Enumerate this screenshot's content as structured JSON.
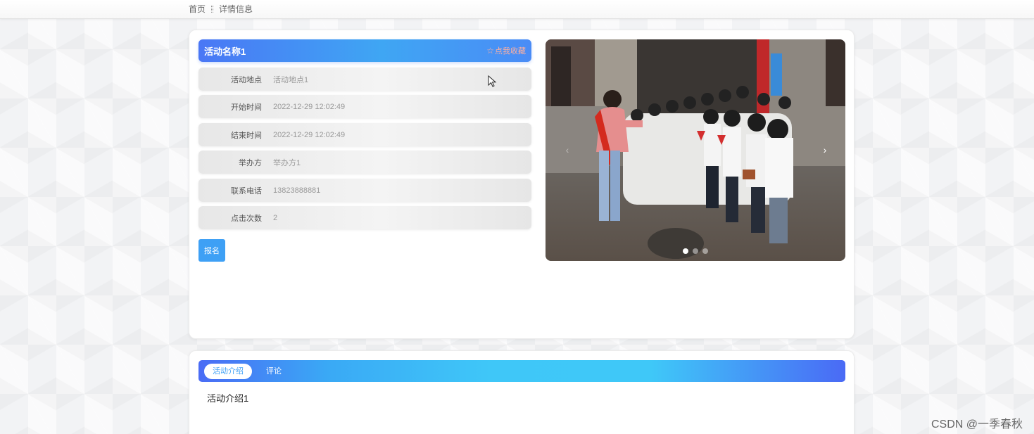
{
  "breadcrumb": {
    "home": "首页",
    "current": "详情信息"
  },
  "activity": {
    "title": "活动名称1",
    "favorite_label": "点我收藏",
    "fields": [
      {
        "label": "活动地点",
        "value": "活动地点1"
      },
      {
        "label": "开始时间",
        "value": "2022-12-29 12:02:49"
      },
      {
        "label": "结束时间",
        "value": "2022-12-29 12:02:49"
      },
      {
        "label": "举办方",
        "value": "举办方1"
      },
      {
        "label": "联系电话",
        "value": "13823888881"
      },
      {
        "label": "点击次数",
        "value": "2"
      }
    ],
    "signup_label": "报名"
  },
  "carousel": {
    "slide_count": 3,
    "active_index": 0,
    "prev_arrow": "‹",
    "next_arrow": "›"
  },
  "tabs": {
    "items": [
      {
        "label": "活动介绍"
      },
      {
        "label": "评论"
      }
    ],
    "active_index": 0,
    "content": "活动介绍1"
  },
  "watermark": "CSDN @一季春秋",
  "colors": {
    "accent": "#3ea0f5",
    "title_gradient_start": "#4a77f5",
    "favorite_text": "#ffb0a0"
  }
}
